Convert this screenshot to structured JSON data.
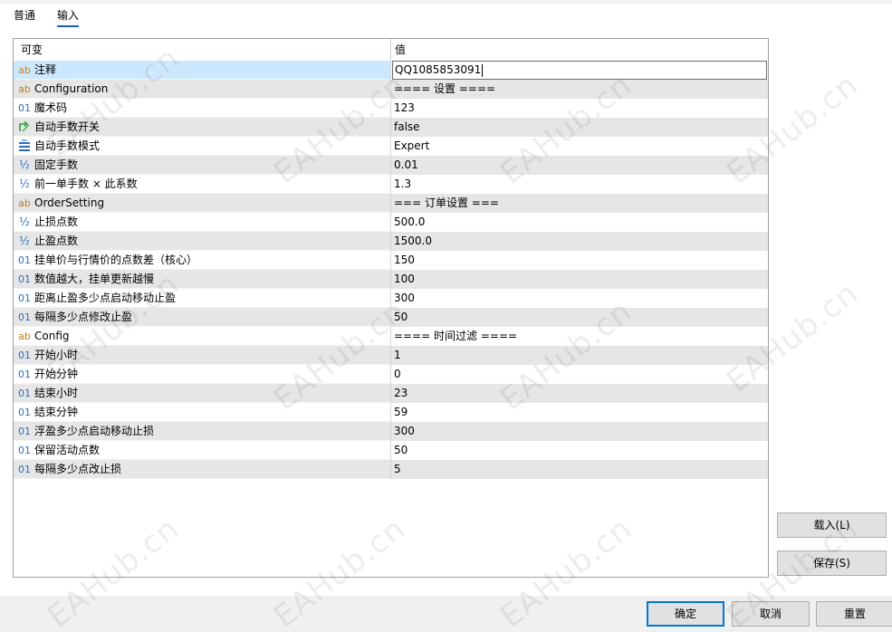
{
  "tabs": [
    {
      "label": "普通",
      "active": false
    },
    {
      "label": "输入",
      "active": true
    }
  ],
  "grid": {
    "col_variable": "可变",
    "col_value": "值",
    "rows": [
      {
        "type": "ab",
        "name": "注释",
        "value": "QQ1085853091",
        "editing": true
      },
      {
        "type": "ab",
        "name": "Configuration",
        "value": "==== 设置 ===="
      },
      {
        "type": "int",
        "name": "魔术码",
        "value": "123"
      },
      {
        "type": "bool",
        "name": "自动手数开关",
        "value": "false"
      },
      {
        "type": "enum",
        "name": "自动手数模式",
        "value": "Expert"
      },
      {
        "type": "double",
        "name": "固定手数",
        "value": "0.01"
      },
      {
        "type": "double",
        "name": "前一单手数 × 此系数",
        "value": "1.3"
      },
      {
        "type": "ab",
        "name": "OrderSetting",
        "value": "=== 订单设置 ==="
      },
      {
        "type": "double",
        "name": "止损点数",
        "value": "500.0"
      },
      {
        "type": "double",
        "name": "止盈点数",
        "value": "1500.0"
      },
      {
        "type": "int",
        "name": "挂单价与行情价的点数差（核心）",
        "value": "150"
      },
      {
        "type": "int",
        "name": "数值越大，挂单更新越慢",
        "value": "100"
      },
      {
        "type": "int",
        "name": "距离止盈多少点启动移动止盈",
        "value": "300"
      },
      {
        "type": "int",
        "name": "每隔多少点修改止盈",
        "value": "50"
      },
      {
        "type": "ab",
        "name": "Config",
        "value": "==== 时间过滤 ===="
      },
      {
        "type": "int",
        "name": "开始小时",
        "value": "1"
      },
      {
        "type": "int",
        "name": "开始分钟",
        "value": "0"
      },
      {
        "type": "int",
        "name": "结束小时",
        "value": "23"
      },
      {
        "type": "int",
        "name": "结束分钟",
        "value": "59"
      },
      {
        "type": "int",
        "name": "浮盈多少点启动移动止损",
        "value": "300"
      },
      {
        "type": "int",
        "name": "保留活动点数",
        "value": "50"
      },
      {
        "type": "int",
        "name": "每隔多少点改止损",
        "value": "5"
      }
    ]
  },
  "type_glyphs": {
    "ab": "ab",
    "int": "01",
    "double": "½"
  },
  "buttons": {
    "load": "载入(L)",
    "save": "保存(S)",
    "ok": "确定",
    "cancel": "取消",
    "reset": "重置"
  },
  "watermark": "EAHub.cn",
  "colors": {
    "accent": "#0078d7",
    "selected_row": "#cce8ff",
    "alt_row": "#e6e6e6"
  }
}
